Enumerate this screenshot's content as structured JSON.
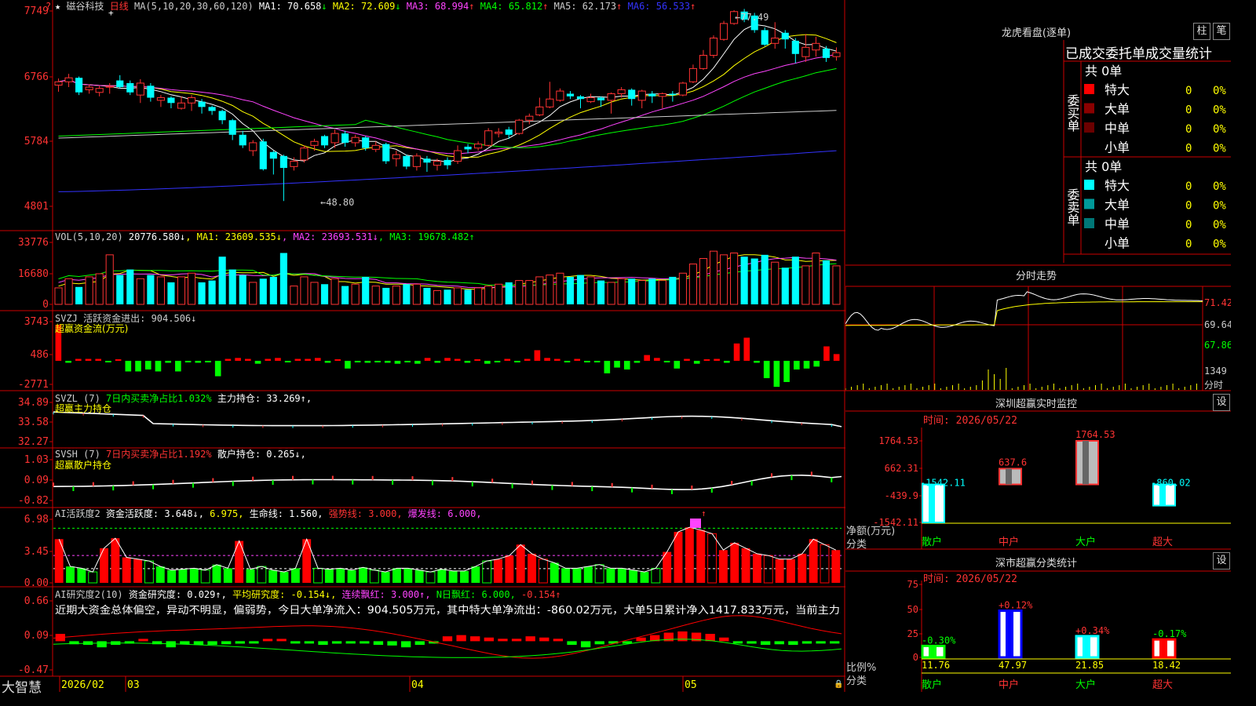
{
  "header": {
    "stock_name": "磁谷科技",
    "period": "日线",
    "ma_params": "MA(5,10,20,30,60,120)",
    "ma_items": [
      {
        "label": "MA1: 70.658",
        "arrow": "↓",
        "color": "#ffffff"
      },
      {
        "label": "MA2: 72.609",
        "arrow": "↓",
        "color": "#ffff00"
      },
      {
        "label": "MA3: 68.994",
        "arrow": "↑",
        "color": "#ff44ff"
      },
      {
        "label": "MA4: 65.812",
        "arrow": "↑",
        "color": "#00ff00"
      },
      {
        "label": "MA5: 62.173",
        "arrow": "↑",
        "color": "#cccccc"
      },
      {
        "label": "MA6: 56.533",
        "arrow": "↑",
        "color": "#3333ff"
      }
    ]
  },
  "price_axis": [
    "7749",
    "6766",
    "5784",
    "4801"
  ],
  "price_annotations": {
    "high": "77.49",
    "low": "48.80"
  },
  "vol_header": {
    "name": "VOL(5,10,20)",
    "vol": "20776.580↓",
    "ma1": "MA1: 23609.535↓",
    "ma2": "MA2: 23693.531↓",
    "ma3": "MA3: 19678.482↑"
  },
  "vol_axis": [
    "33776",
    "16680",
    "0"
  ],
  "svzj": {
    "line1": "SVZJ  活跃资金进出: 904.506↓",
    "line2": "超赢资金流(万元)",
    "axis": [
      "3743",
      "486",
      "-2771"
    ]
  },
  "svzl": {
    "name": "SVZL (7)",
    "txt1": "7日内买卖净占比1.032%",
    "txt2": "主力持仓: 33.269↑,",
    "line2": "超赢主力持仓",
    "axis": [
      "34.89",
      "33.58",
      "32.27"
    ]
  },
  "svsh": {
    "name": "SVSH (7)",
    "txt1": "7日内买卖净占比1.192%",
    "txt2": "散户持仓: 0.265↓,",
    "line2": "超赢散户持仓",
    "axis": [
      "1.03",
      "0.09",
      "-0.82"
    ]
  },
  "ai1": {
    "name": "AI活跃度2",
    "t1": "资金活跃度: 3.648↓",
    "t2": "6.975,",
    "t3": "生命线: 1.560,",
    "t4": "强势线: 3.000,",
    "t5": "爆发线: 6.000,",
    "axis": [
      "6.98",
      "3.45",
      "0.00"
    ]
  },
  "ai2": {
    "name": "AI研究度2(10)",
    "t1": "资金研究度: 0.029↑,",
    "t2": "平均研究度: -0.154↓,",
    "t3": "连续飘红: 3.000↑,",
    "t4": "N日飘红: 6.000,",
    "t5": "-0.154↑",
    "note": "近期大资金总体偏空，异动不明显，偏弱势，今日大单净流入：904.505万元，其中特大单净流出：-860.02万元，大单5日累计净入1417.833万元，当前主力",
    "axis": [
      "0.66",
      "0.09",
      "-0.47"
    ]
  },
  "bottom": {
    "brand": "大智慧",
    "dates": [
      "2026/02",
      "03",
      "04",
      "05"
    ]
  },
  "right": {
    "dragon_title": "龙虎看盘(逐单)",
    "tab1": "柱",
    "tab2": "笔",
    "stat_header": "已成交委托单成交量统计",
    "buy_group": {
      "label": "委买单",
      "total": "共 0单",
      "rows": [
        {
          "name": "特大",
          "count": "0",
          "pct": "0%",
          "color": "#ff0000"
        },
        {
          "name": "大单",
          "count": "0",
          "pct": "0%",
          "color": "#8b0000"
        },
        {
          "name": "中单",
          "count": "0",
          "pct": "0%",
          "color": "#6b0000"
        },
        {
          "name": "小单",
          "count": "0",
          "pct": "0%",
          "color": ""
        }
      ]
    },
    "sell_group": {
      "label": "委卖单",
      "total": "共 0单",
      "rows": [
        {
          "name": "特大",
          "count": "0",
          "pct": "0%",
          "color": "#00ffff"
        },
        {
          "name": "大单",
          "count": "0",
          "pct": "0%",
          "color": "#009999"
        },
        {
          "name": "中单",
          "count": "0",
          "pct": "0%",
          "color": "#007777"
        },
        {
          "name": "小单",
          "count": "0",
          "pct": "0%",
          "color": ""
        }
      ]
    },
    "intraday_title": "分时走势",
    "intraday_axis": [
      "71.42",
      "69.64",
      "67.86",
      "1349",
      "分时"
    ],
    "sz_title": "深圳超赢实时监控",
    "sz_set": "设",
    "sz_time": "时间: 2026/05/22",
    "sz_axis": [
      "1764.53",
      "662.31",
      "-439.9",
      "-1542.11"
    ],
    "sz_axis_label1": "净额(万元)",
    "sz_axis_label2": "分类",
    "sz_cats": [
      "散户",
      "中户",
      "大户",
      "超大"
    ],
    "sz_value_labels": [
      "-1542.11",
      "637.6",
      "1764.53",
      "-860.02"
    ],
    "ss_title": "深市超赢分类统计",
    "ss_set": "设",
    "ss_time": "时间: 2026/05/22",
    "ss_axis": [
      "75",
      "50",
      "25",
      "0"
    ],
    "ss_axis_label1": "比例%",
    "ss_axis_label2": "分类",
    "ss_top_labels": [
      "-0.30%",
      "+0.12%",
      "+0.34%",
      "-0.17%"
    ],
    "ss_bottom_labels": [
      "11.76",
      "47.97",
      "21.85",
      "18.42"
    ],
    "ss_cats": [
      "散户",
      "中户",
      "大户",
      "超大"
    ]
  },
  "chart_data": [
    {
      "type": "candlestick",
      "series_name": "磁谷科技 日线",
      "dates_shown": [
        "2026/02",
        "03",
        "04",
        "05"
      ],
      "ylim": [
        48.0,
        78.5
      ],
      "candles": [
        [
          66.3,
          66.8,
          65.3,
          67.3
        ],
        [
          66.8,
          67.4,
          66.0,
          68.0
        ],
        [
          67.4,
          65.2,
          64.8,
          67.6
        ],
        [
          65.6,
          66.0,
          65.0,
          66.4
        ],
        [
          65.2,
          65.8,
          64.6,
          66.2
        ],
        [
          66.0,
          66.1,
          65.0,
          66.6
        ],
        [
          67.0,
          66.0,
          65.8,
          67.8
        ],
        [
          66.6,
          65.2,
          64.8,
          67.0
        ],
        [
          64.8,
          66.6,
          63.6,
          67.2
        ],
        [
          66.2,
          64.4,
          63.8,
          66.6
        ],
        [
          64.0,
          64.4,
          63.0,
          64.8
        ],
        [
          64.4,
          63.6,
          62.8,
          64.6
        ],
        [
          62.8,
          63.6,
          62.6,
          64.6
        ],
        [
          63.6,
          64.4,
          62.4,
          64.8
        ],
        [
          63.8,
          63.0,
          62.0,
          64.2
        ],
        [
          63.0,
          62.4,
          61.8,
          63.2
        ],
        [
          62.4,
          61.0,
          60.4,
          62.6
        ],
        [
          61.0,
          58.8,
          58.0,
          61.2
        ],
        [
          58.8,
          57.2,
          56.8,
          59.4
        ],
        [
          56.4,
          57.6,
          55.6,
          58.0
        ],
        [
          57.8,
          53.6,
          53.4,
          58.2
        ],
        [
          56.2,
          55.2,
          52.8,
          56.4
        ],
        [
          55.6,
          53.8,
          48.8,
          55.8
        ],
        [
          54.0,
          54.8,
          53.4,
          55.4
        ],
        [
          55.0,
          56.8,
          54.6,
          57.2
        ],
        [
          57.2,
          57.8,
          56.4,
          58.2
        ],
        [
          58.6,
          57.2,
          56.8,
          58.8
        ],
        [
          57.6,
          59.0,
          56.8,
          59.6
        ],
        [
          59.0,
          57.6,
          57.0,
          59.4
        ],
        [
          57.6,
          58.4,
          57.0,
          58.8
        ],
        [
          58.4,
          56.8,
          56.4,
          58.6
        ],
        [
          56.6,
          57.2,
          56.2,
          57.8
        ],
        [
          57.4,
          54.8,
          54.4,
          57.6
        ],
        [
          55.2,
          55.8,
          54.0,
          56.4
        ],
        [
          55.6,
          54.0,
          53.6,
          55.8
        ],
        [
          54.0,
          55.6,
          53.4,
          56.0
        ],
        [
          55.2,
          54.6,
          53.2,
          55.6
        ],
        [
          54.2,
          54.8,
          53.4,
          55.2
        ],
        [
          55.0,
          54.2,
          53.6,
          55.4
        ],
        [
          54.8,
          56.4,
          54.4,
          57.2
        ],
        [
          57.0,
          56.6,
          56.0,
          57.4
        ],
        [
          56.8,
          57.4,
          56.4,
          57.8
        ],
        [
          57.2,
          59.4,
          57.0,
          59.8
        ],
        [
          59.0,
          59.2,
          58.4,
          59.8
        ],
        [
          59.6,
          58.8,
          58.2,
          60.0
        ],
        [
          59.0,
          61.0,
          58.8,
          61.2
        ],
        [
          61.0,
          61.6,
          60.4,
          62.0
        ],
        [
          61.8,
          63.0,
          61.6,
          64.4
        ],
        [
          63.0,
          64.2,
          62.8,
          66.8
        ],
        [
          64.0,
          65.4,
          63.8,
          65.8
        ],
        [
          65.0,
          64.6,
          64.2,
          65.4
        ],
        [
          64.6,
          64.2,
          62.8,
          64.8
        ],
        [
          63.8,
          64.4,
          63.6,
          65.0
        ],
        [
          64.4,
          64.0,
          63.0,
          64.6
        ],
        [
          64.0,
          65.0,
          62.0,
          65.2
        ],
        [
          65.0,
          65.6,
          64.4,
          66.0
        ],
        [
          65.6,
          64.2,
          63.2,
          65.8
        ],
        [
          64.0,
          65.4,
          62.8,
          65.6
        ],
        [
          65.0,
          64.6,
          63.6,
          65.4
        ],
        [
          64.6,
          65.0,
          62.8,
          65.2
        ],
        [
          65.0,
          64.8,
          63.8,
          65.4
        ],
        [
          64.8,
          66.6,
          64.6,
          66.8
        ],
        [
          66.8,
          68.8,
          66.6,
          69.4
        ],
        [
          68.8,
          70.8,
          68.6,
          71.6
        ],
        [
          70.8,
          73.4,
          70.4,
          73.8
        ],
        [
          73.2,
          75.6,
          73.0,
          76.0
        ],
        [
          75.6,
          77.4,
          75.4,
          77.6
        ],
        [
          77.4,
          76.2,
          75.8,
          77.8
        ],
        [
          76.8,
          74.6,
          74.2,
          77.2
        ],
        [
          74.6,
          72.4,
          72.2,
          75.0
        ],
        [
          72.6,
          73.4,
          71.8,
          75.8
        ],
        [
          74.2,
          73.2,
          71.8,
          74.6
        ],
        [
          73.0,
          71.0,
          69.6,
          73.4
        ],
        [
          70.6,
          72.0,
          69.8,
          74.0
        ],
        [
          71.6,
          72.6,
          70.6,
          73.6
        ],
        [
          71.8,
          70.4,
          69.8,
          72.2
        ],
        [
          70.6,
          71.2,
          70.0,
          72.0
        ]
      ],
      "ma_series": [
        {
          "name": "MA1",
          "color": "#ffffff",
          "current": 70.658
        },
        {
          "name": "MA2",
          "color": "#ffff00",
          "current": 72.609
        },
        {
          "name": "MA3",
          "color": "#ff44ff",
          "current": 68.994
        },
        {
          "name": "MA4",
          "color": "#00ff00",
          "current": 65.812
        },
        {
          "name": "MA5",
          "color": "#cccccc",
          "current": 62.173
        },
        {
          "name": "MA6",
          "color": "#3333ff",
          "current": 56.533
        }
      ]
    },
    {
      "type": "bar",
      "series_name": "VOL",
      "ylim": [
        0,
        33776
      ],
      "values": [
        9000,
        14000,
        9500,
        15000,
        16680,
        27000,
        16000,
        19000,
        14000,
        16000,
        15000,
        12000,
        15000,
        17000,
        12000,
        13000,
        26000,
        19000,
        16000,
        12000,
        14000,
        15000,
        28000,
        10000,
        15000,
        12000,
        11000,
        14000,
        10000,
        11000,
        15000,
        10000,
        9000,
        10000,
        11000,
        11000,
        9000,
        7500,
        8000,
        9000,
        8000,
        9000,
        10000,
        11000,
        12000,
        13000,
        13000,
        15000,
        16000,
        17000,
        15000,
        16000,
        15000,
        13000,
        12000,
        14000,
        14000,
        13000,
        14000,
        13000,
        15000,
        17000,
        22000,
        25000,
        29000,
        27000,
        28000,
        26000,
        25000,
        27000,
        23000,
        20000,
        26000,
        21000,
        28000,
        24000,
        21000
      ]
    },
    {
      "type": "bar",
      "series_name": "SVZJ 超赢资金流(万元)",
      "ylim": [
        -2771,
        3743
      ],
      "values": [
        3743,
        -200,
        200,
        200,
        200,
        -150,
        100,
        -1100,
        -1100,
        -900,
        -1100,
        -200,
        -1100,
        -100,
        -200,
        -100,
        -1600,
        200,
        300,
        200,
        -300,
        200,
        300,
        -100,
        200,
        200,
        300,
        -200,
        100,
        -800,
        -150,
        -200,
        -100,
        -200,
        -300,
        -100,
        -300,
        300,
        -200,
        300,
        200,
        -200,
        100,
        -300,
        -100,
        200,
        -100,
        200,
        1100,
        300,
        200,
        -100,
        200,
        -150,
        -100,
        -1300,
        -700,
        -900,
        -200,
        600,
        300,
        -100,
        -800,
        200,
        -300,
        100,
        200,
        -200,
        1800,
        2400,
        -200,
        -1800,
        -2700,
        -2200,
        -900,
        -800,
        -600,
        1500,
        700
      ]
    },
    {
      "type": "line",
      "series_name": "SVZL 主力持仓",
      "ylim": [
        32.27,
        34.89
      ],
      "current": 33.269
    },
    {
      "type": "line",
      "series_name": "SVSH 散户持仓",
      "ylim": [
        -0.82,
        1.03
      ],
      "current": 0.265
    },
    {
      "type": "bar",
      "series_name": "AI活跃度2 资金活跃度",
      "ylim": [
        0,
        6.98
      ],
      "reference_lines": [
        {
          "name": "生命线",
          "value": 1.56
        },
        {
          "name": "强势线",
          "value": 3.0
        },
        {
          "name": "爆发线",
          "value": 6.0
        }
      ],
      "values": [
        4.8,
        1.8,
        1.6,
        1.2,
        3.8,
        4.9,
        2.8,
        2.6,
        2.4,
        1.8,
        1.4,
        1.5,
        1.6,
        1.4,
        2.0,
        1.6,
        4.6,
        1.5,
        1.8,
        1.4,
        1.2,
        1.6,
        4.8,
        1.6,
        1.5,
        1.6,
        1.4,
        1.7,
        1.4,
        1.2,
        1.6,
        1.6,
        1.4,
        1.2,
        1.5,
        1.3,
        1.3,
        1.8,
        2.4,
        2.6,
        3.0,
        4.2,
        3.2,
        2.6,
        2.2,
        1.6,
        1.6,
        1.8,
        2.0,
        1.6,
        1.6,
        1.4,
        1.2,
        1.6,
        3.4,
        5.6,
        6.1,
        5.8,
        5.4,
        3.6,
        4.4,
        3.8,
        3.2,
        3.0,
        2.6,
        2.6,
        3.2,
        4.8,
        4.2,
        3.6
      ]
    },
    {
      "type": "bar",
      "series_name": "AI研究度2(10) 资金研究度",
      "ylim": [
        -0.47,
        0.66
      ],
      "values": [
        0.12,
        -0.05,
        -0.06,
        -0.1,
        -0.06,
        -0.04,
        0.02,
        -0.05,
        -0.1,
        -0.05,
        -0.06,
        -0.06,
        -0.05,
        -0.04,
        -0.03,
        0.02,
        0.02,
        -0.02,
        -0.03,
        -0.06,
        -0.04,
        -0.03,
        -0.02,
        -0.06,
        -0.07,
        -0.1,
        -0.06,
        -0.03,
        0.08,
        0.1,
        0.08,
        0.06,
        0.04,
        0.04,
        0.08,
        0.06,
        0.04,
        -0.06,
        -0.1,
        -0.05,
        -0.04,
        -0.04,
        0.06,
        0.1,
        0.14,
        0.16,
        0.14,
        0.12,
        0.06,
        -0.02,
        -0.04,
        -0.06,
        -0.05,
        -0.06,
        -0.04,
        -0.02,
        -0.03
      ]
    },
    {
      "type": "line",
      "series_name": "分时走势",
      "ylim": [
        67.86,
        71.42
      ]
    },
    {
      "type": "bar",
      "series_name": "深圳超赢实时监控",
      "categories": [
        "散户",
        "中户",
        "大户",
        "超大"
      ],
      "values": [
        -1542.11,
        637.6,
        1764.53,
        -860.02
      ],
      "ylim": [
        -1542.11,
        1764.53
      ],
      "ylabel": "净额(万元)"
    },
    {
      "type": "bar",
      "series_name": "深市超赢分类统计",
      "categories": [
        "散户",
        "中户",
        "大户",
        "超大"
      ],
      "values": [
        11.76,
        47.97,
        21.85,
        18.42
      ],
      "changes": [
        "-0.30%",
        "+0.12%",
        "+0.34%",
        "-0.17%"
      ],
      "ylim": [
        0,
        75
      ],
      "ylabel": "比例%"
    }
  ]
}
